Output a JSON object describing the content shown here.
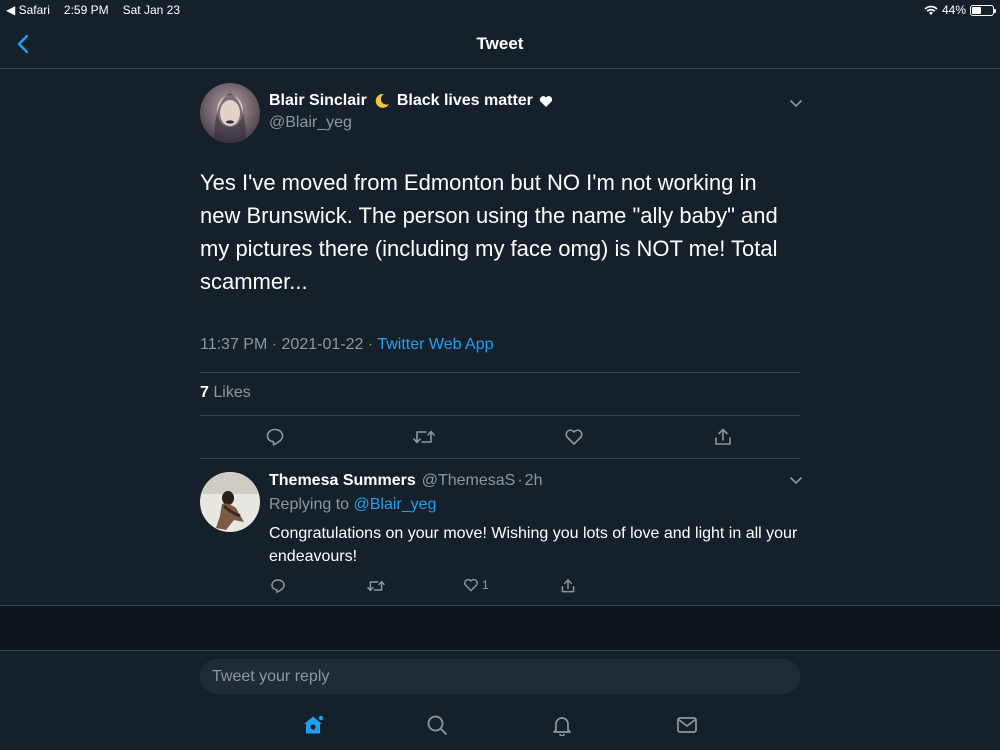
{
  "status_bar": {
    "back_app": "◀ Safari",
    "time": "2:59 PM",
    "date": "Sat Jan 23",
    "battery": "44%",
    "battery_level": 0.44
  },
  "nav": {
    "title": "Tweet"
  },
  "tweet": {
    "author_name": "Blair Sinclair",
    "author_suffix": "Black lives matter",
    "author_handle": "@Blair_yeg",
    "text": "Yes I've moved from Edmonton but NO I'm not working in new Brunswick. The person using the name \"ally baby\" and my pictures there (including my face omg) is NOT me! Total scammer...",
    "time": "11:37 PM",
    "date": "2021-01-22",
    "separator": "·",
    "source": "Twitter Web App",
    "likes_count": "7",
    "likes_label": "Likes"
  },
  "reply": {
    "author_name": "Themesa Summers",
    "author_handle": "@ThemesaS",
    "age": "2h",
    "replying_to_label": "Replying to",
    "replying_to_handle": "@Blair_yeg",
    "text": "Congratulations on your move! Wishing you lots of love and light in all your endeavours!",
    "like_count": "1"
  },
  "compose": {
    "placeholder": "Tweet your reply"
  },
  "tabbar": {
    "items": [
      "home-icon",
      "search-icon",
      "notifications-icon",
      "messages-icon"
    ],
    "active": "home-icon"
  },
  "colors": {
    "background": "#15202b",
    "accent": "#1da1f2",
    "secondary_text": "#8899a6",
    "divider": "#38444d"
  }
}
